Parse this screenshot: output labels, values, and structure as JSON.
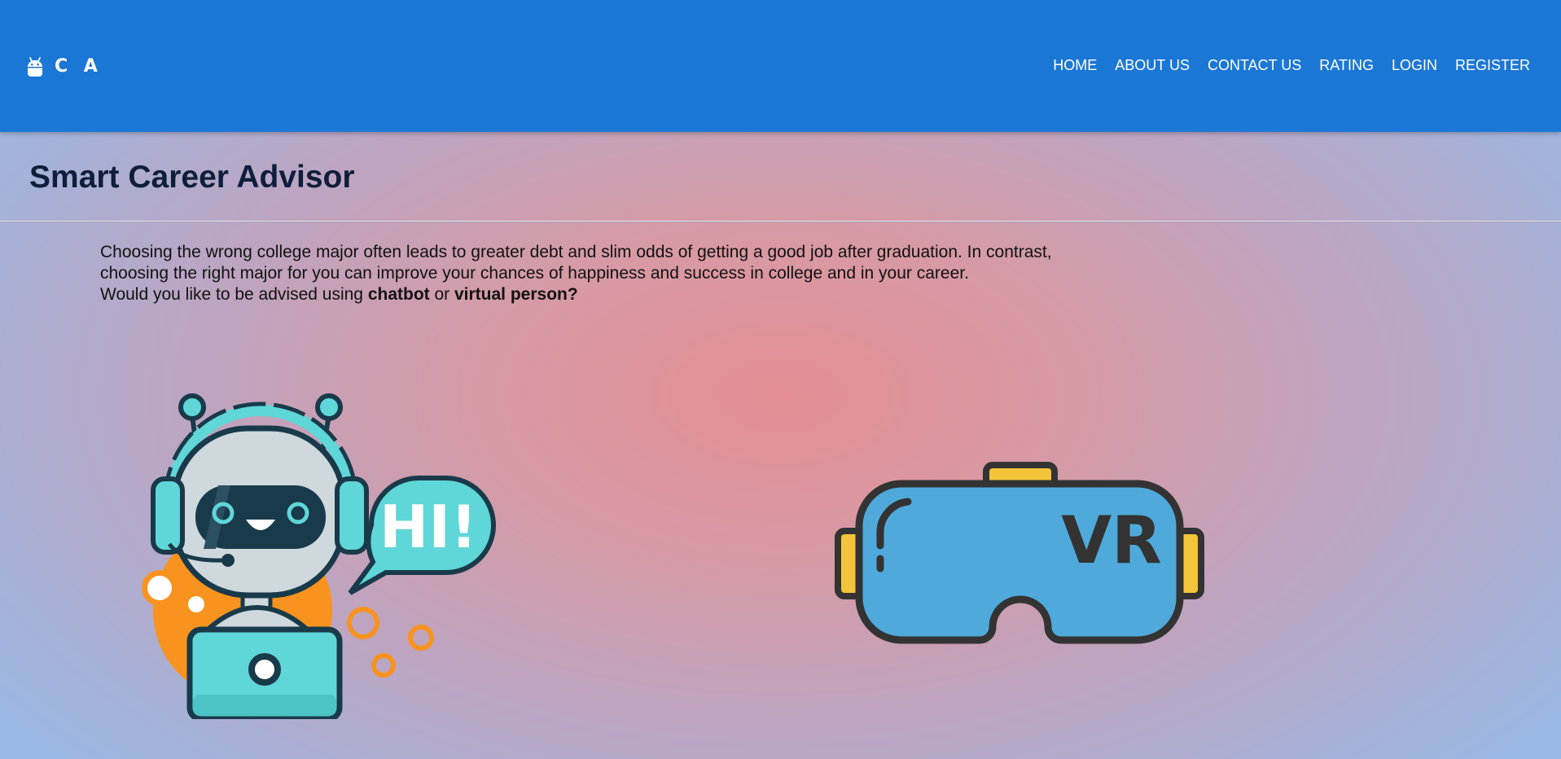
{
  "navbar": {
    "brand_text": "C A",
    "brand_icon": "android-icon",
    "background": "#1b77d5",
    "links": [
      {
        "label": "HOME"
      },
      {
        "label": "ABOUT US"
      },
      {
        "label": "CONTACT US"
      },
      {
        "label": "RATING"
      },
      {
        "label": "LOGIN"
      },
      {
        "label": "REGISTER"
      }
    ]
  },
  "main": {
    "title": "Smart Career Advisor",
    "intro_line1": "Choosing the wrong college major often leads to greater debt and slim odds of getting a good job after graduation. In contrast,",
    "intro_line2": "choosing the right major for you can improve your chances of happiness and success in college and in your career.",
    "question_prefix": "Would you like to be advised using ",
    "option_chatbot": "chatbot",
    "question_or": " or ",
    "option_virtual": "virtual person?"
  },
  "options": {
    "chatbot": {
      "speech_bubble_text": "HI!",
      "icon": "chatbot-robot-icon"
    },
    "vr": {
      "headset_text": "VR",
      "icon": "vr-headset-icon"
    }
  },
  "colors": {
    "title_text": "#0f1e3a",
    "robot_teal": "#5fd6d7",
    "robot_orange": "#f7931e",
    "vr_blue": "#4faadb",
    "vr_yellow": "#f4c53a",
    "outline": "#333333"
  }
}
